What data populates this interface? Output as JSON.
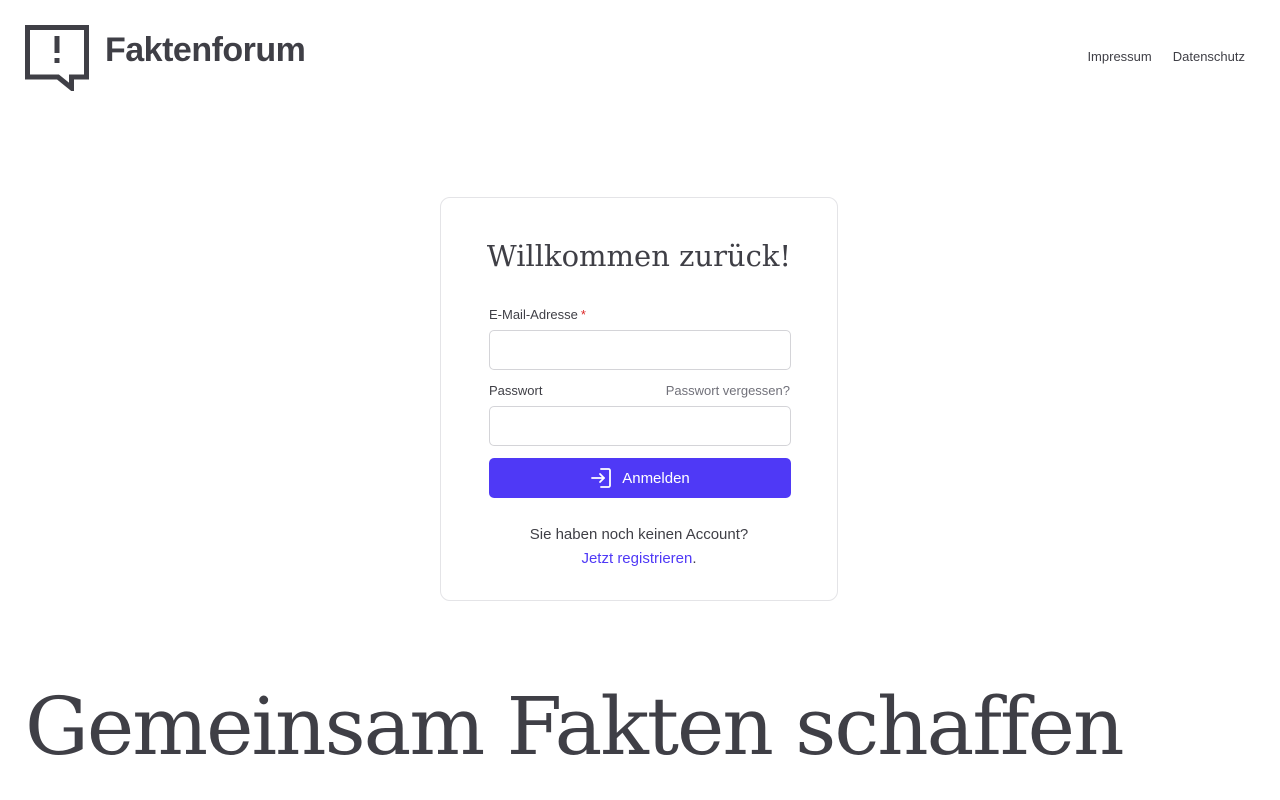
{
  "header": {
    "brand": "Faktenforum",
    "nav": [
      {
        "label": "Impressum"
      },
      {
        "label": "Datenschutz"
      }
    ]
  },
  "login": {
    "title": "Willkommen zurück!",
    "email_label": "E-Mail-Adresse",
    "required_mark": "*",
    "email_value": "",
    "password_label": "Passwort",
    "forgot_label": "Passwort vergessen?",
    "password_value": "",
    "submit_label": "Anmelden",
    "submit_icon": "login-icon",
    "no_account_text": "Sie haben noch keinen Account?",
    "register_link": "Jetzt registrieren",
    "register_suffix": "."
  },
  "hero": {
    "headline": "Gemeinsam Fakten schaffen"
  },
  "colors": {
    "accent": "#4f39f6",
    "text": "#3f3f46",
    "required": "#dc2626",
    "border": "#e4e4e7"
  }
}
